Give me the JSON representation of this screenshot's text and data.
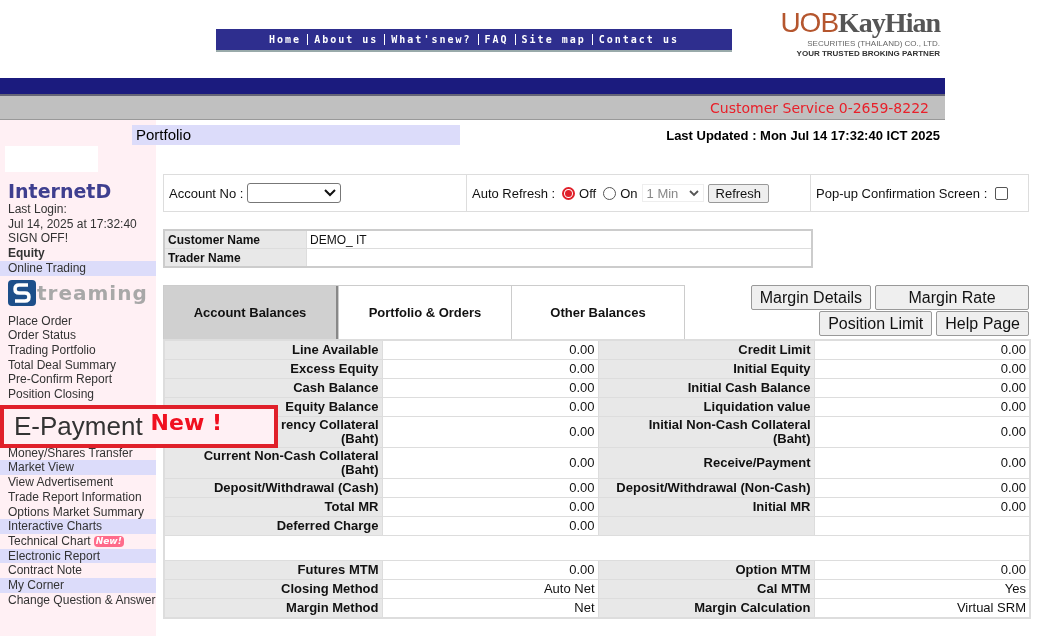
{
  "nav": [
    "Home",
    "About us",
    "What'snew?",
    "FAQ",
    "Site map",
    "Contact us"
  ],
  "logo": {
    "brand_a": "UOB",
    "brand_b": "KayHian",
    "company": "SECURITIES (THAILAND) CO., LTD.",
    "tagline": "YOUR TRUSTED BROKING PARTNER"
  },
  "customer_service": "Customer Service 0-2659-8222",
  "page_title": "Portfolio",
  "last_updated": "Last Updated : Mon Jul 14 17:32:40 ICT 2025",
  "sidebar": {
    "items": [
      {
        "kind": "brand",
        "label": "InternetD"
      },
      {
        "kind": "text",
        "label": "Last Login:"
      },
      {
        "kind": "text",
        "label": "Jul 14, 2025 at 17:32:40"
      },
      {
        "kind": "link",
        "label": "SIGN OFF!"
      },
      {
        "kind": "bold",
        "label": "Equity"
      },
      {
        "kind": "section",
        "label": "Online Trading"
      },
      {
        "kind": "logo",
        "label": "treaming"
      },
      {
        "kind": "link",
        "label": "Place Order"
      },
      {
        "kind": "link",
        "label": "Order Status"
      },
      {
        "kind": "link",
        "label": "Trading Portfolio"
      },
      {
        "kind": "link",
        "label": "Total Deal Summary"
      },
      {
        "kind": "link",
        "label": "Pre-Confirm Report"
      },
      {
        "kind": "link",
        "label": "Position Closing"
      },
      {
        "kind": "hidden"
      },
      {
        "kind": "link",
        "label": "Money/Shares Transfer"
      },
      {
        "kind": "section",
        "label": "Market View"
      },
      {
        "kind": "link",
        "label": "View Advertisement"
      },
      {
        "kind": "link",
        "label": "Trade Report Information"
      },
      {
        "kind": "link",
        "label": "Options Market Summary"
      },
      {
        "kind": "section",
        "label": "Interactive Charts"
      },
      {
        "kind": "link",
        "label": "Technical Chart",
        "badge": "New!"
      },
      {
        "kind": "section",
        "label": "Electronic Report"
      },
      {
        "kind": "link",
        "label": "Contract Note"
      },
      {
        "kind": "section",
        "label": "My Corner"
      },
      {
        "kind": "link",
        "label": "Change Question & Answer"
      }
    ]
  },
  "epayment": {
    "label": "E-Payment",
    "badge": "New !"
  },
  "controls": {
    "account_label": "Account No :",
    "auto_refresh_label": "Auto Refresh :",
    "refresh_options": [
      {
        "label": "Off",
        "selected": true
      },
      {
        "label": "On",
        "selected": false
      }
    ],
    "interval": "1 Min",
    "refresh_button": "Refresh",
    "popup_label": "Pop-up Confirmation Screen :",
    "popup_checked": false
  },
  "customer": [
    {
      "label": "Customer Name",
      "value": "DEMO_ IT"
    },
    {
      "label": "Trader Name"
    }
  ],
  "tabs": [
    {
      "label": "Account Balances",
      "selected": true
    },
    {
      "label": "Portfolio & Orders",
      "selected": false
    },
    {
      "label": "Other Balances",
      "selected": false
    }
  ],
  "buttons": [
    [
      "Margin Details",
      "Margin Rate"
    ],
    [
      "Position Limit",
      "Help Page"
    ]
  ],
  "balances": [
    {
      "kind": "data",
      "cells": [
        "Line Available",
        "0.00",
        "Credit Limit",
        "0.00"
      ]
    },
    {
      "kind": "data",
      "cells": [
        "Excess Equity",
        "0.00",
        "Initial Equity",
        "0.00"
      ]
    },
    {
      "kind": "data",
      "cells": [
        "Cash Balance",
        "0.00",
        "Initial Cash Balance",
        "0.00"
      ]
    },
    {
      "kind": "data",
      "cells": [
        "Equity Balance",
        "0.00",
        "Liquidation value",
        "0.00"
      ]
    },
    {
      "kind": "data",
      "cells": [
        "rency Collateral\n(Baht)",
        "0.00",
        "Initial Non-Cash Collateral\n(Baht)",
        "0.00"
      ]
    },
    {
      "kind": "data",
      "cells": [
        "Current Non-Cash Collateral\n(Baht)",
        "0.00",
        "Receive/Payment",
        "0.00"
      ]
    },
    {
      "kind": "data",
      "cells": [
        "Deposit/Withdrawal (Cash)",
        "0.00",
        "Deposit/Withdrawal (Non-Cash)",
        "0.00"
      ]
    },
    {
      "kind": "data",
      "cells": [
        "Total MR",
        "0.00",
        "Initial MR",
        "0.00"
      ]
    },
    {
      "kind": "data",
      "cells": [
        "Deferred Charge",
        "0.00"
      ]
    },
    {
      "kind": "blank"
    },
    {
      "kind": "data",
      "cells": [
        "Futures MTM",
        "0.00",
        "Option MTM",
        "0.00"
      ]
    },
    {
      "kind": "data",
      "cells": [
        "Closing Method",
        "Auto Net",
        "Cal MTM",
        "Yes"
      ]
    },
    {
      "kind": "data",
      "cells": [
        "Margin Method",
        "Net",
        "Margin Calculation",
        "Virtual SRM"
      ]
    }
  ]
}
